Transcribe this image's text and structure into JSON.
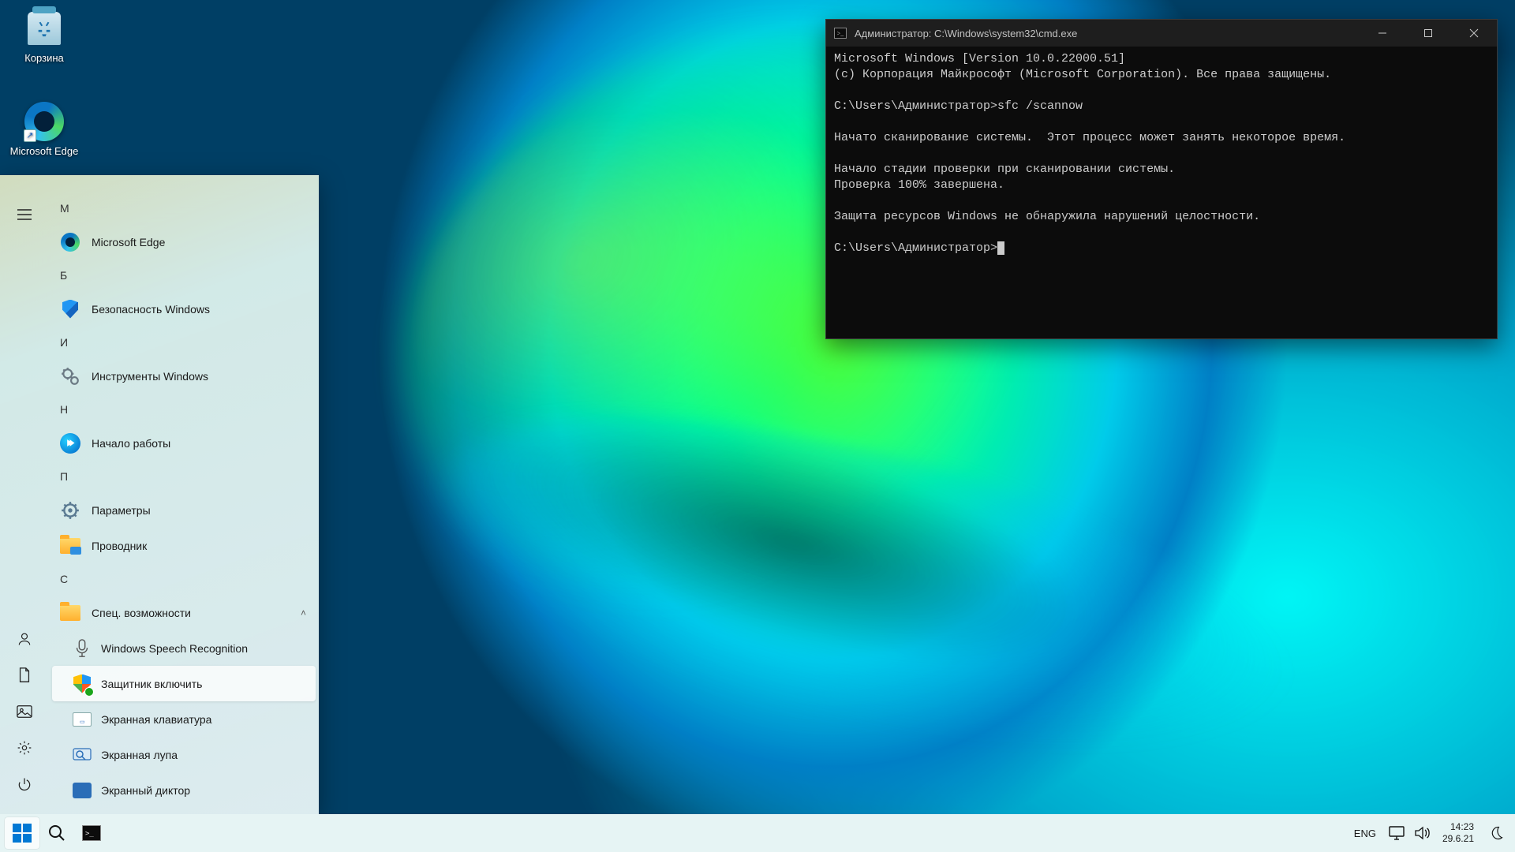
{
  "desktop_icons": {
    "recycle_bin": "Корзина",
    "edge": "Microsoft Edge"
  },
  "start_menu": {
    "groups": [
      {
        "letter": "М",
        "apps": [
          {
            "id": "edge",
            "label": "Microsoft Edge"
          }
        ]
      },
      {
        "letter": "Б",
        "apps": [
          {
            "id": "security",
            "label": "Безопасность Windows"
          }
        ]
      },
      {
        "letter": "И",
        "apps": [
          {
            "id": "tools",
            "label": "Инструменты Windows"
          }
        ]
      },
      {
        "letter": "Н",
        "apps": [
          {
            "id": "getstarted",
            "label": "Начало работы"
          }
        ]
      },
      {
        "letter": "П",
        "apps": [
          {
            "id": "settings",
            "label": "Параметры"
          },
          {
            "id": "explorer",
            "label": "Проводник"
          }
        ]
      },
      {
        "letter": "С",
        "apps": [
          {
            "id": "access",
            "label": "Спец. возможности",
            "expanded": true,
            "children": [
              {
                "id": "speech",
                "label": "Windows Speech Recognition"
              },
              {
                "id": "defender",
                "label": "Защитник включить",
                "selected": true
              },
              {
                "id": "osk",
                "label": "Экранная клавиатура"
              },
              {
                "id": "magnifier",
                "label": "Экранная лупа"
              },
              {
                "id": "narrator",
                "label": "Экранный диктор"
              }
            ]
          }
        ]
      }
    ]
  },
  "cmd": {
    "title": "Администратор: C:\\Windows\\system32\\cmd.exe",
    "lines": [
      "Microsoft Windows [Version 10.0.22000.51]",
      "(c) Корпорация Майкрософт (Microsoft Corporation). Все права защищены.",
      "",
      "C:\\Users\\Администратор>sfc /scannow",
      "",
      "Начато сканирование системы.  Этот процесс может занять некоторое время.",
      "",
      "Начало стадии проверки при сканировании системы.",
      "Проверка 100% завершена.",
      "",
      "Защита ресурсов Windows не обнаружила нарушений целостности.",
      "",
      "C:\\Users\\Администратор>"
    ]
  },
  "taskbar": {
    "lang": "ENG",
    "time": "14:23",
    "date": "29.6.21"
  }
}
